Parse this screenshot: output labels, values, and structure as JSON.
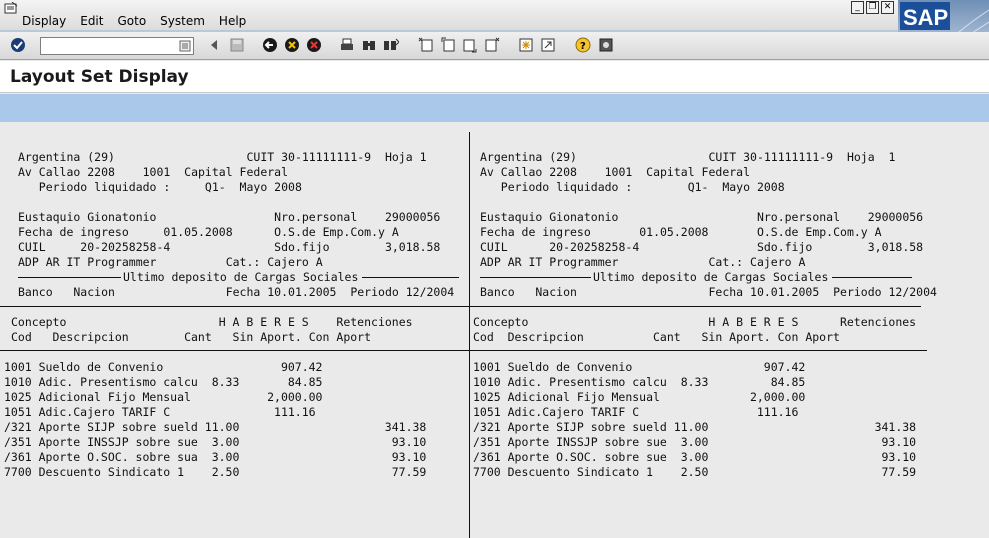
{
  "menu": {
    "items": [
      "Display",
      "Edit",
      "Goto",
      "System",
      "Help"
    ]
  },
  "window_controls": {
    "minimize": "_",
    "restore": "❐",
    "close": "✕"
  },
  "logo": {
    "text": "SAP"
  },
  "toolbar": {
    "command_field_value": "",
    "icons": [
      "enter-icon",
      "command-field",
      "back-icon",
      "save-icon",
      "back-arrow-icon",
      "exit-icon",
      "cancel-icon",
      "print-icon",
      "find-icon",
      "find-next-icon",
      "first-page-icon",
      "previous-page-icon",
      "next-page-icon",
      "last-page-icon",
      "create-session-icon",
      "shortcut-icon",
      "help-icon",
      "layout-menu-icon"
    ]
  },
  "page": {
    "title": "Layout Set Display"
  },
  "forms": [
    {
      "header": [
        "Argentina (29)                   CUIT 30-11111111-9  Hoja 1",
        "Av Callao 2208    1001  Capital Federal",
        "   Periodo liquidado :     Q1-  Mayo 2008",
        "",
        "Eustaquio Gionatonio                 Nro.personal    29000056",
        "Fecha de ingreso     01.05.2008      O.S.de Emp.Com.y A",
        "CUIL     20-20258258-4               Sdo.fijo        3,018.58",
        "ADP AR IT Programmer          Cat.: Cajero A"
      ],
      "section_title": "Ultimo deposito de Cargas Sociales",
      "bank_line": "Banco   Nacion                Fecha 10.01.2005  Periodo 12/2004",
      "columns_line1": "Concepto                      H A B E R E S    Retenciones",
      "columns_line2": "Cod   Descripcion        Cant   Sin Aport. Con Aport",
      "rows": [
        "1001 Sueldo de Convenio                 907.42",
        "1010 Adic. Presentismo calcu  8.33       84.85",
        "1025 Adicional Fijo Mensual           2,000.00",
        "1051 Adic.Cajero TARIF C               111.16",
        "/321 Aporte SIJP sobre sueld 11.00                     341.38",
        "/351 Aporte INSSJP sobre sue  3.00                      93.10",
        "/361 Aporte O.SOC. sobre sua  3.00                      93.10",
        "7700 Descuento Sindicato 1    2.50                      77.59"
      ]
    },
    {
      "header": [
        "Argentina (29)                   CUIT 30-11111111-9  Hoja  1",
        "Av Callao 2208    1001  Capital Federal",
        "   Periodo liquidado :        Q1-  Mayo 2008",
        "",
        "Eustaquio Gionatonio                    Nro.personal    29000056",
        "Fecha de ingreso       01.05.2008       O.S.de Emp.Com.y A",
        "CUIL      20-20258258-4                 Sdo.fijo        3,018.58",
        "ADP AR IT Programmer             Cat.: Cajero A"
      ],
      "section_title": "Ultimo deposito de Cargas Sociales",
      "bank_line": "Banco   Nacion                   Fecha 10.01.2005  Periodo 12/2004",
      "columns_line1": "Concepto                          H A B E R E S      Retenciones",
      "columns_line2": "Cod  Descripcion          Cant   Sin Aport. Con Aport",
      "rows": [
        "1001 Sueldo de Convenio                   907.42",
        "1010 Adic. Presentismo calcu  8.33         84.85",
        "1025 Adicional Fijo Mensual             2,000.00",
        "1051 Adic.Cajero TARIF C                 111.16",
        "/321 Aporte SIJP sobre sueld 11.00                        341.38",
        "/351 Aporte INSSJP sobre sue  3.00                         93.10",
        "/361 Aporte O.SOC. sobre sue  3.00                         93.10",
        "7700 Descuento Sindicato 1    2.50                         77.59"
      ]
    }
  ]
}
